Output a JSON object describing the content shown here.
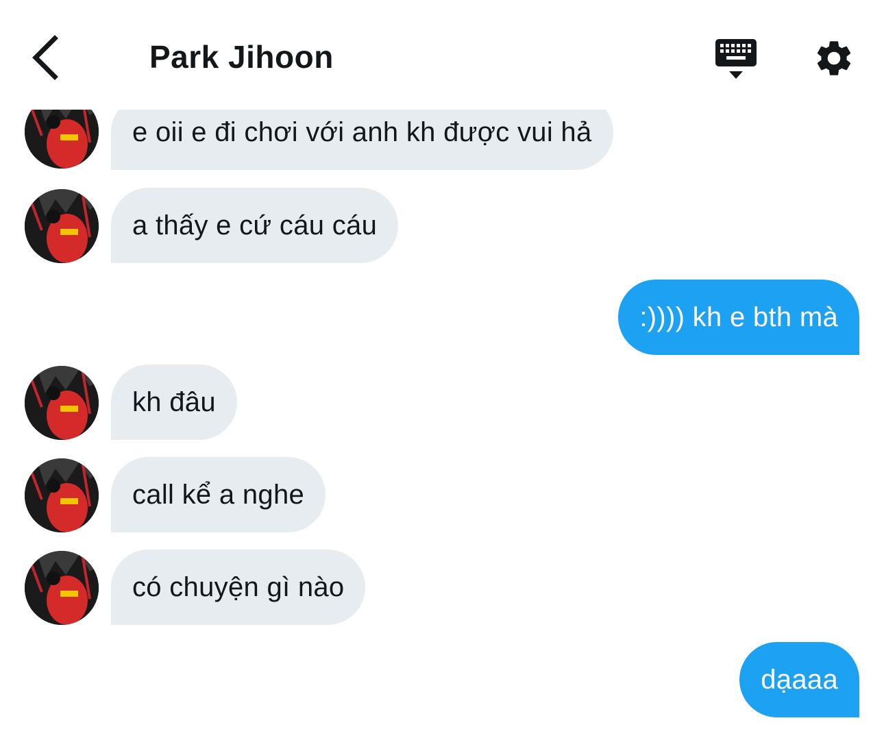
{
  "header": {
    "title": "Park Jihoon",
    "back_icon": "chevron-left-icon",
    "keyboard_icon": "keyboard-icon",
    "settings_icon": "gear-icon"
  },
  "colors": {
    "incoming_bubble": "#e6ecf0",
    "outgoing_bubble": "#1da1f2",
    "text_dark": "#14171a"
  },
  "messages": [
    {
      "direction": "in",
      "text": "e oii e đi chơi với anh kh được vui hả"
    },
    {
      "direction": "in",
      "text": "a thấy e cứ cáu cáu"
    },
    {
      "direction": "out",
      "text": ":)))) kh e bth mà"
    },
    {
      "direction": "in",
      "text": "kh đâu"
    },
    {
      "direction": "in",
      "text": "call kể a nghe"
    },
    {
      "direction": "in",
      "text": "có chuyện gì nào"
    },
    {
      "direction": "out",
      "text": "dạaaa"
    }
  ]
}
